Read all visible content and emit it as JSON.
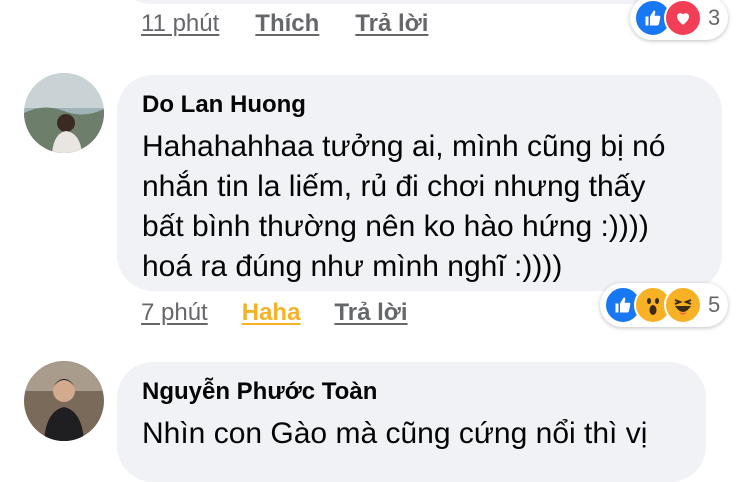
{
  "comment1": {
    "time": "11 phút",
    "like": "Thích",
    "reply": "Trả lời",
    "reaction_count": "3"
  },
  "comment2": {
    "author": "Do Lan Huong",
    "text_lines": [
      "Hahahahhaa tưởng ai, mình cũng bị nó",
      "nhắn tin la liếm, rủ đi chơi nhưng thấy",
      "bất bình thường nên ko hào hứng :))))",
      "hoá ra đúng như mình nghĩ :))))"
    ],
    "time": "7 phút",
    "reaction_label": "Haha",
    "reply": "Trả lời",
    "reaction_count": "5"
  },
  "comment3": {
    "author": "Nguyễn Phước Toàn",
    "text": "Nhìn con Gào mà cũng cứng nổi thì vị"
  },
  "colors": {
    "bubble": "#f0f2f5",
    "meta": "#65676b",
    "haha": "#f7b125",
    "like": "#1877f2",
    "love": "#f33e58"
  }
}
